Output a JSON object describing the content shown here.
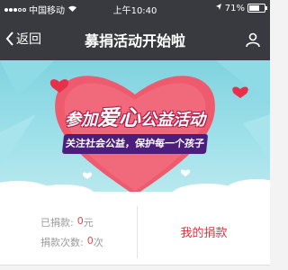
{
  "status_bar": {
    "carrier": "中国移动",
    "time": "上午10:40",
    "battery": "71%",
    "battery_level": 0.71
  },
  "nav": {
    "back_label": "返回",
    "title": "募捐活动开始啦"
  },
  "banner": {
    "title_pre": "参加",
    "title_big": "爱心",
    "title_post": "公益活动",
    "ribbon": "关注社会公益，保护每一个孩子"
  },
  "stats": {
    "donated_label": "已捐款:",
    "donated_value": "0",
    "donated_unit": "元",
    "count_label": "捐款次数:",
    "count_value": "0",
    "count_unit": "次",
    "my_donation": "我的捐款"
  },
  "colors": {
    "bar": "#393a3f",
    "accent": "#d9363e",
    "value": "#e04a4a"
  }
}
